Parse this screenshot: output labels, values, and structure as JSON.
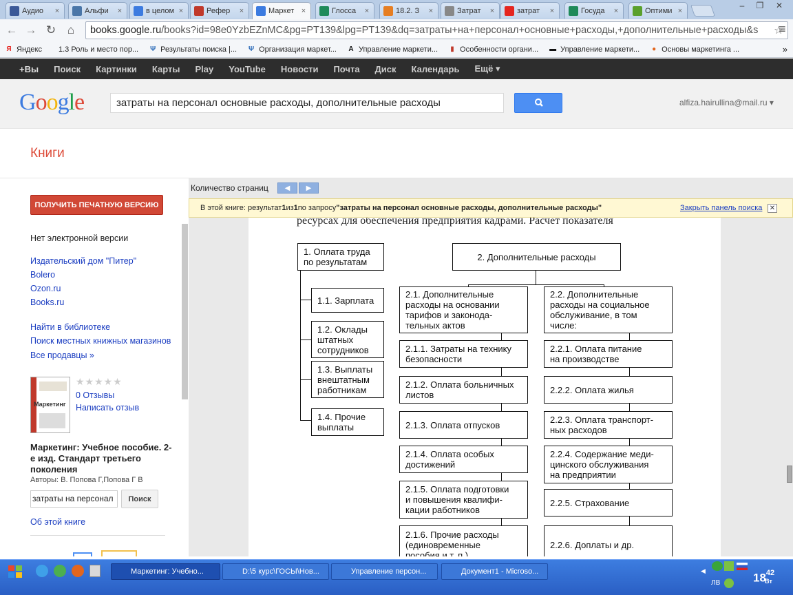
{
  "browser": {
    "tabs": [
      {
        "label": "Аудио",
        "icon": "play-icon",
        "color": "#3b5998",
        "active": false
      },
      {
        "label": "Альфи",
        "icon": "vk-icon",
        "color": "#4a76a8",
        "active": false
      },
      {
        "label": "в целом",
        "icon": "google-icon",
        "color": "#3c7be0",
        "active": false
      },
      {
        "label": "Рефер",
        "icon": "doc-icon",
        "color": "#c0392b",
        "active": false
      },
      {
        "label": "Маркет",
        "icon": "google-icon",
        "color": "#3c7be0",
        "active": true
      },
      {
        "label": "Глосса",
        "icon": "page-icon",
        "color": "#1f8a5a",
        "active": false
      },
      {
        "label": "18.2. З",
        "icon": "lock-icon",
        "color": "#e67e22",
        "active": false
      },
      {
        "label": "Затрат",
        "icon": "r-icon",
        "color": "#888888",
        "active": false
      },
      {
        "label": "затрат",
        "icon": "yandex-icon",
        "color": "#e52620",
        "active": false
      },
      {
        "label": "Госуда",
        "icon": "page-icon",
        "color": "#1f8a5a",
        "active": false
      },
      {
        "label": "Оптими",
        "icon": "check-icon",
        "color": "#5aa02c",
        "active": false
      }
    ],
    "url_host": "books.google.ru",
    "url_rest": "/books?id=98e0YzbEZnMC&pg=PT139&lpg=PT139&dq=затраты+на+персонал+основные+расходы,+дополнительные+расходы&s"
  },
  "bookmarks": [
    {
      "label": "Яндекс",
      "icon": "yandex-icon"
    },
    {
      "label": "1.3 Роль и место пор...",
      "icon": "none"
    },
    {
      "label": "Результаты поиска |...",
      "icon": "psi-icon"
    },
    {
      "label": "Организация маркет...",
      "icon": "psi-icon"
    },
    {
      "label": "Управление маркети...",
      "icon": "a-icon"
    },
    {
      "label": "Особенности органи...",
      "icon": "book-icon"
    },
    {
      "label": "Управление маркети...",
      "icon": "flag-icon"
    },
    {
      "label": "Основы маркетинга ...",
      "icon": "circle-icon"
    }
  ],
  "gbar": [
    "+Вы",
    "Поиск",
    "Картинки",
    "Карты",
    "Play",
    "YouTube",
    "Новости",
    "Почта",
    "Диск",
    "Календарь",
    "Ещё ▾"
  ],
  "header": {
    "logo": "Google",
    "search_value": "затраты на персонал основные расходы, дополнительные расходы",
    "account": "alfiza.hairullina@mail.ru ▾"
  },
  "books": {
    "title": "Книги"
  },
  "left": {
    "print_button": "ПОЛУЧИТЬ ПЕЧАТНУЮ ВЕРСИЮ",
    "no_ebook": "Нет электронной версии",
    "sellers": [
      "Издательский дом \"Питер\"",
      "Bolero",
      "Ozon.ru",
      "Books.ru"
    ],
    "library": "Найти в библиотеке",
    "local_stores": "Поиск местных книжных магазинов",
    "all_sellers": "Все продавцы »",
    "stars": "★★★★★",
    "reviews": "0 Отзывы",
    "write_review": "Написать отзыв",
    "cover_title": "Маркетинг",
    "book_title": "Маркетинг: Учебное пособие. 2-е изд. Стандарт третьего поколения",
    "authors": "Авторы: В. Попова Г,Попова Г В",
    "inbook_search": "затраты на персонал",
    "inbook_button": "Поиск",
    "about": "Об этой книге"
  },
  "viewer": {
    "page_count_label": "Количество страниц",
    "info_prefix": "В этой книге: результат ",
    "info_n": "1",
    "info_of": " из ",
    "info_total": "1",
    "info_query_prefix": " по запросу ",
    "info_query": "\"затраты на персонал основные расходы, дополнительные расходы\"",
    "close_panel": "Закрыть панель поиска",
    "page_top_text": "ресурсах для обеспечения предприятия кадрами. Расчет показателя"
  },
  "diagram": {
    "b1": [
      "1. Оплата труда",
      "по результатам"
    ],
    "b11": [
      "1.1. Зарплата"
    ],
    "b12": [
      "1.2. Оклады",
      "штатных",
      "сотрудников"
    ],
    "b13": [
      "1.3. Выплаты",
      "внештатным",
      "работникам"
    ],
    "b14": [
      "1.4. Прочие",
      "выплаты"
    ],
    "b2": [
      "2. Дополнительные расходы"
    ],
    "b21": [
      "2.1. Дополнительные",
      "расходы  на основании",
      "тарифов и законода-",
      "тельных актов"
    ],
    "b211": [
      "2.1.1. Затраты на технику",
      "безопасности"
    ],
    "b212": [
      "2.1.2. Оплата больничных",
      "листов"
    ],
    "b213": [
      "2.1.3. Оплата отпусков"
    ],
    "b214": [
      "2.1.4. Оплата особых",
      "достижений"
    ],
    "b215": [
      "2.1.5. Оплата подготовки",
      "и повышения квалифи-",
      "кации работников"
    ],
    "b216": [
      "2.1.6. Прочие расходы",
      "(единовременные",
      "пособия и т. п.)"
    ],
    "b22": [
      "2.2. Дополнительные",
      "расходы на социальное",
      "обслуживание, в том",
      "числе:"
    ],
    "b221": [
      "2.2.1. Оплата питание",
      "на производстве"
    ],
    "b222": [
      "2.2.2. Оплата жилья"
    ],
    "b223": [
      "2.2.3. Оплата транспорт-",
      "ных расходов"
    ],
    "b224": [
      "2.2.4. Содержание меди-",
      "цинского обслуживания",
      "на предприятии"
    ],
    "b225": [
      "2.2.5. Страхование"
    ],
    "b226": [
      "2.2.6. Доплаты и др."
    ]
  },
  "taskbar": {
    "buttons": [
      "Маркетинг: Учебно...",
      "D:\\5 курс\\ГОСЫ\\Нов...",
      "Управление персон...",
      "Документ1 - Microso..."
    ],
    "clock_hours": "18",
    "clock_minutes": "42",
    "clock_day": "Вт",
    "lang": "ЛВ"
  }
}
